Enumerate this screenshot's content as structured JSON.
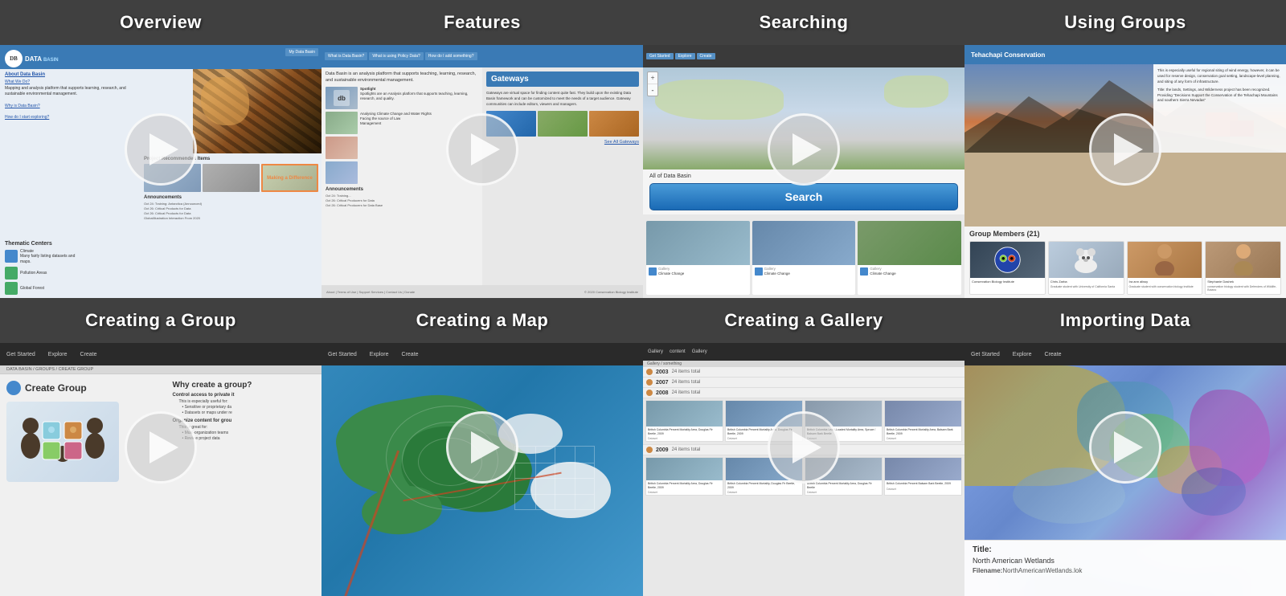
{
  "cards": [
    {
      "id": "overview",
      "title": "Overview",
      "row": 1,
      "col": 1
    },
    {
      "id": "features",
      "title": "Features",
      "row": 1,
      "col": 2
    },
    {
      "id": "searching",
      "title": "Searching",
      "row": 1,
      "col": 3
    },
    {
      "id": "using-groups",
      "title": "Using Groups",
      "row": 1,
      "col": 4
    },
    {
      "id": "creating-group",
      "title": "Creating a Group",
      "row": 2,
      "col": 1
    },
    {
      "id": "creating-map",
      "title": "Creating a Map",
      "row": 2,
      "col": 2
    },
    {
      "id": "creating-gallery",
      "title": "Creating a Gallery",
      "row": 2,
      "col": 3
    },
    {
      "id": "importing-data",
      "title": "Importing Data",
      "row": 2,
      "col": 4
    }
  ],
  "overview": {
    "title": "Overview",
    "logo": "DATA BASIN",
    "nav_items": [
      "What We Do?",
      "Why is Data Basin?",
      "How do I start exploring?"
    ],
    "sidebar_items": [
      {
        "color": "#4488cc",
        "label": "Climate"
      },
      {
        "color": "#44aa66",
        "label": "Pollution Areas"
      },
      {
        "color": "#44aa66",
        "label": "Global Forest"
      }
    ],
    "section_title": "Thematic Centers",
    "making_difference": "Making a Difference",
    "recommended": "Project Recommended Items",
    "announcements": "Announcements"
  },
  "features": {
    "title": "Features",
    "nav_items": [
      "What is Data Basin?",
      "What is using Policy Data?",
      "How do I add something?"
    ],
    "gateways_title": "Gateways",
    "gateways_desc": "Gateways are virtual space for finding content quite fast. They build upon the existing Data Basin framework and can be customized to meet the needs of a target audience. Gateway communities can include editors, viewers and managers.",
    "spotlight_label": "Spotlight",
    "announcements": "Announcements",
    "see_all": "See All Gateways"
  },
  "searching": {
    "title": "Searching",
    "search_button": "Search",
    "all_of_label": "All of Data Basin",
    "results": [
      {
        "type": "Gallery",
        "label": "Climate Change"
      },
      {
        "type": "Gallery",
        "label": "Climate Change"
      },
      {
        "type": "Gallery",
        "label": "Climate Change"
      }
    ]
  },
  "using_groups": {
    "title": "Using Groups",
    "group_members_title": "Group Members (21)",
    "members": [
      {
        "name": "Conservation Biology Institute",
        "role": ""
      },
      {
        "name": "Chris Zarba",
        "role": "Graduate student with University of California Santa"
      },
      {
        "name": "Ira ann alissy",
        "role": "Graduate student with conservation biology institute"
      },
      {
        "name": "Stephanie Dashek",
        "role": "conservation biology student with Defenders of Wildlife-Botano"
      }
    ],
    "para": "This is especially useful for regional siting of wind energy, however, it can be used for reserve design, conservation goal setting, landscape-level planning, and siting of any form of infrastructure."
  },
  "creating_group": {
    "title": "Creating a Group",
    "page_title": "Create Group",
    "nav_items": [
      "Get Started",
      "Explore",
      "Create"
    ],
    "breadcrumb": "DATA BASIN / GROUPS / CREATE GROUP",
    "why_title": "Why create a group?",
    "control_access": "Control access to private it",
    "bullets": [
      "Sensitive or proprietary da",
      "Datasets or maps under re"
    ],
    "organize_title": "Organize content for grou",
    "organize_bullets": [
      "Multi-organization teams",
      "Review project data"
    ]
  },
  "creating_map": {
    "title": "Creating a Map",
    "nav_items": [
      "Get Started",
      "Explore",
      "Create"
    ]
  },
  "creating_gallery": {
    "title": "Creating a Gallery",
    "nav_items": [
      "Gallery",
      "content",
      "Gallery"
    ],
    "breadcrumb": "Gallery / something",
    "years": [
      {
        "year": "2003",
        "count": "24 items total"
      },
      {
        "year": "2007",
        "count": "24 items total"
      },
      {
        "year": "2008",
        "count": "24 items total"
      },
      {
        "year": "2009",
        "count": "24 items total"
      }
    ],
    "items": [
      {
        "label": "British Columbia Percent Mortality Area, Douglas Fir Beetle, 2009",
        "type": "Dataset"
      },
      {
        "label": "British Columbia Percent Mortality Area, Douglas Fir Beetle, 2009",
        "type": "Dataset"
      },
      {
        "label": "British Columbia Least-Loaded Mortality Area, Spruce / Balsam Bark Beetle",
        "type": "Dataset"
      },
      {
        "label": "British Columbia Percent Mortality Area, Balsam Bark Beetle, 2009",
        "type": "Dataset"
      }
    ]
  },
  "importing_data": {
    "title": "Importing Data",
    "title_label": "Title:",
    "title_value": "North American Wetlands",
    "filename_label": "Filename:",
    "filename_value": "NorthAmericanWetlands.lok"
  }
}
